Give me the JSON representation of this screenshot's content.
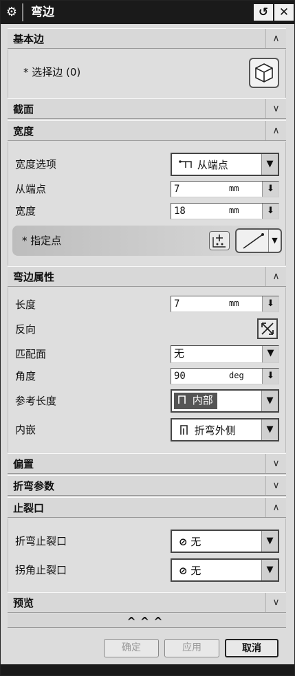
{
  "window": {
    "title": "弯边",
    "reset_symbol": "↺",
    "close_symbol": "✕"
  },
  "icons": {
    "gear": "gear-icon",
    "cube": "cube-icon",
    "point": "point-constructor-icon",
    "line": "line-vector-icon",
    "flip": "reverse-direction-icon"
  },
  "sections": {
    "basic_edge": {
      "title": "基本边",
      "chevron": "∧",
      "select_edge_label": "* 选择边 (0)"
    },
    "profile": {
      "title": "截面",
      "chevron": "∨"
    },
    "width": {
      "title": "宽度",
      "chevron": "∧",
      "width_option_label": "宽度选项",
      "width_option_value": "从端点",
      "from_endpoint_label": "从端点",
      "from_endpoint_value": "7",
      "from_endpoint_unit": "mm",
      "width_label": "宽度",
      "width_value": "18",
      "width_unit": "mm",
      "specify_point_label": "* 指定点"
    },
    "flange_props": {
      "title": "弯边属性",
      "chevron": "∧",
      "length_label": "长度",
      "length_value": "7",
      "length_unit": "mm",
      "reverse_label": "反向",
      "match_face_label": "匹配面",
      "match_face_value": "无",
      "angle_label": "角度",
      "angle_value": "90",
      "angle_unit": "deg",
      "ref_length_label": "参考长度",
      "ref_length_value": "内部",
      "inset_label": "内嵌",
      "inset_value": "折弯外侧"
    },
    "offset": {
      "title": "偏置",
      "chevron": "∨"
    },
    "bend_params": {
      "title": "折弯参数",
      "chevron": "∨"
    },
    "relief": {
      "title": "止裂口",
      "chevron": "∧",
      "bend_relief_label": "折弯止裂口",
      "bend_relief_value": "无",
      "corner_relief_label": "拐角止裂口",
      "corner_relief_value": "无"
    },
    "preview": {
      "title": "预览",
      "chevron": "∨"
    }
  },
  "more_indicator": "^^^",
  "buttons": {
    "ok": "确定",
    "apply": "应用",
    "cancel": "取消"
  }
}
